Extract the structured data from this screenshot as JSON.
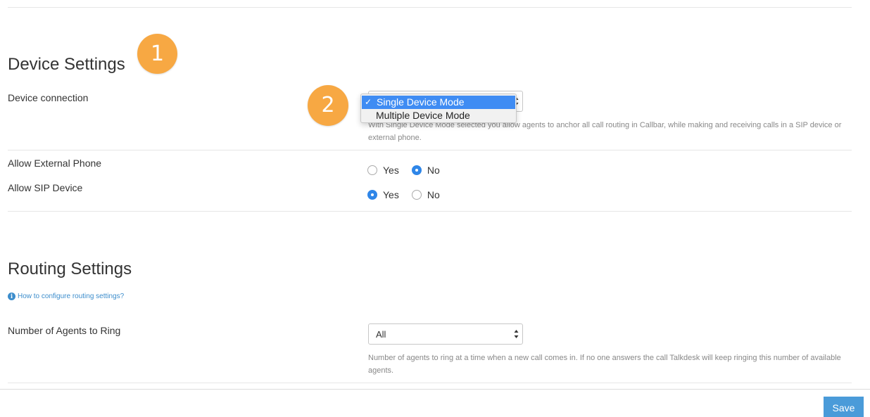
{
  "device_settings": {
    "title": "Device Settings",
    "badge_1": "1",
    "badge_2": "2",
    "device_connection": {
      "label": "Device connection",
      "options": [
        "Single Device Mode",
        "Multiple Device Mode"
      ],
      "selected": "Single Device Mode",
      "check_mark": "✓",
      "help": "With Single Device Mode selected you allow agents to anchor all call routing in Callbar, while making and receiving calls in a SIP device or external phone."
    },
    "allow_external_phone": {
      "label": "Allow External Phone",
      "yes": "Yes",
      "no": "No",
      "value": "No"
    },
    "allow_sip_device": {
      "label": "Allow SIP Device",
      "yes": "Yes",
      "no": "No",
      "value": "Yes"
    }
  },
  "routing_settings": {
    "title": "Routing Settings",
    "help_link": "How to configure routing settings?",
    "agents_to_ring": {
      "label": "Number of Agents to Ring",
      "value": "All",
      "help": "Number of agents to ring at a time when a new call comes in. If no one answers the call Talkdesk will keep ringing this number of available agents."
    }
  },
  "footer": {
    "save_label": "Save"
  },
  "colors": {
    "accent": "#2f86e8",
    "badge": "#f7a843",
    "save": "#4a9bd9",
    "link": "#3c8dcc"
  }
}
